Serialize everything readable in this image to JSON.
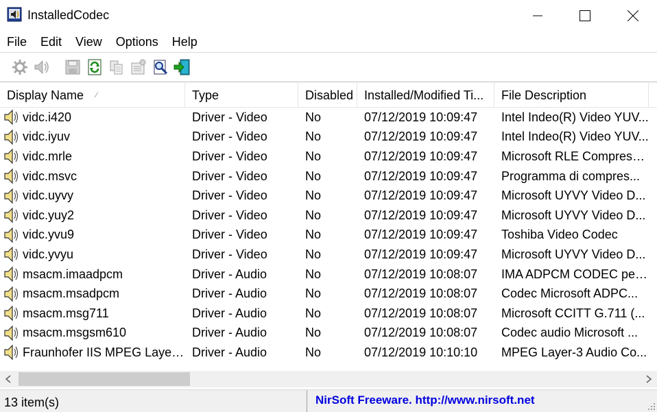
{
  "window": {
    "title": "InstalledCodec",
    "controls": [
      "minimize",
      "maximize",
      "close"
    ]
  },
  "menu": [
    "File",
    "Edit",
    "View",
    "Options",
    "Help"
  ],
  "toolbar": {
    "buttons": [
      {
        "icon": "disable-gear-icon",
        "enabled": false
      },
      {
        "icon": "disable-speaker-icon",
        "enabled": false
      },
      {
        "icon": "save-icon",
        "enabled": false
      },
      {
        "icon": "refresh-icon",
        "enabled": true
      },
      {
        "icon": "copy-icon",
        "enabled": false
      },
      {
        "icon": "properties-icon",
        "enabled": false
      },
      {
        "icon": "find-icon",
        "enabled": true
      },
      {
        "icon": "exit-icon",
        "enabled": true
      }
    ]
  },
  "columns": [
    "Display Name",
    "Type",
    "Disabled",
    "Installed/Modified Ti...",
    "File Description"
  ],
  "rows": [
    {
      "name": "vidc.i420",
      "type": "Driver - Video",
      "disabled": "No",
      "time": "07/12/2019 10:09:47",
      "desc": "Intel Indeo(R) Video YUV..."
    },
    {
      "name": "vidc.iyuv",
      "type": "Driver - Video",
      "disabled": "No",
      "time": "07/12/2019 10:09:47",
      "desc": "Intel Indeo(R) Video YUV..."
    },
    {
      "name": "vidc.mrle",
      "type": "Driver - Video",
      "disabled": "No",
      "time": "07/12/2019 10:09:47",
      "desc": "Microsoft RLE Compress..."
    },
    {
      "name": "vidc.msvc",
      "type": "Driver - Video",
      "disabled": "No",
      "time": "07/12/2019 10:09:47",
      "desc": "Programma di compres..."
    },
    {
      "name": "vidc.uyvy",
      "type": "Driver - Video",
      "disabled": "No",
      "time": "07/12/2019 10:09:47",
      "desc": "Microsoft UYVY Video D..."
    },
    {
      "name": "vidc.yuy2",
      "type": "Driver - Video",
      "disabled": "No",
      "time": "07/12/2019 10:09:47",
      "desc": "Microsoft UYVY Video D..."
    },
    {
      "name": "vidc.yvu9",
      "type": "Driver - Video",
      "disabled": "No",
      "time": "07/12/2019 10:09:47",
      "desc": "Toshiba Video Codec"
    },
    {
      "name": "vidc.yvyu",
      "type": "Driver - Video",
      "disabled": "No",
      "time": "07/12/2019 10:09:47",
      "desc": "Microsoft UYVY Video D..."
    },
    {
      "name": "msacm.imaadpcm",
      "type": "Driver - Audio",
      "disabled": "No",
      "time": "07/12/2019 10:08:07",
      "desc": "IMA ADPCM CODEC per..."
    },
    {
      "name": "msacm.msadpcm",
      "type": "Driver - Audio",
      "disabled": "No",
      "time": "07/12/2019 10:08:07",
      "desc": "Codec Microsoft ADPC..."
    },
    {
      "name": "msacm.msg711",
      "type": "Driver - Audio",
      "disabled": "No",
      "time": "07/12/2019 10:08:07",
      "desc": "Microsoft CCITT G.711 (..."
    },
    {
      "name": "msacm.msgsm610",
      "type": "Driver - Audio",
      "disabled": "No",
      "time": "07/12/2019 10:08:07",
      "desc": "Codec audio Microsoft ..."
    },
    {
      "name": "Fraunhofer IIS MPEG Layer-...",
      "type": "Driver - Audio",
      "disabled": "No",
      "time": "07/12/2019 10:10:10",
      "desc": "MPEG Layer-3 Audio Co..."
    }
  ],
  "status": {
    "count": "13 item(s)",
    "credit": "NirSoft Freeware.  http://www.nirsoft.net"
  },
  "colors": {
    "link": "#0000e0",
    "statusbar": "#f0f0f0"
  }
}
